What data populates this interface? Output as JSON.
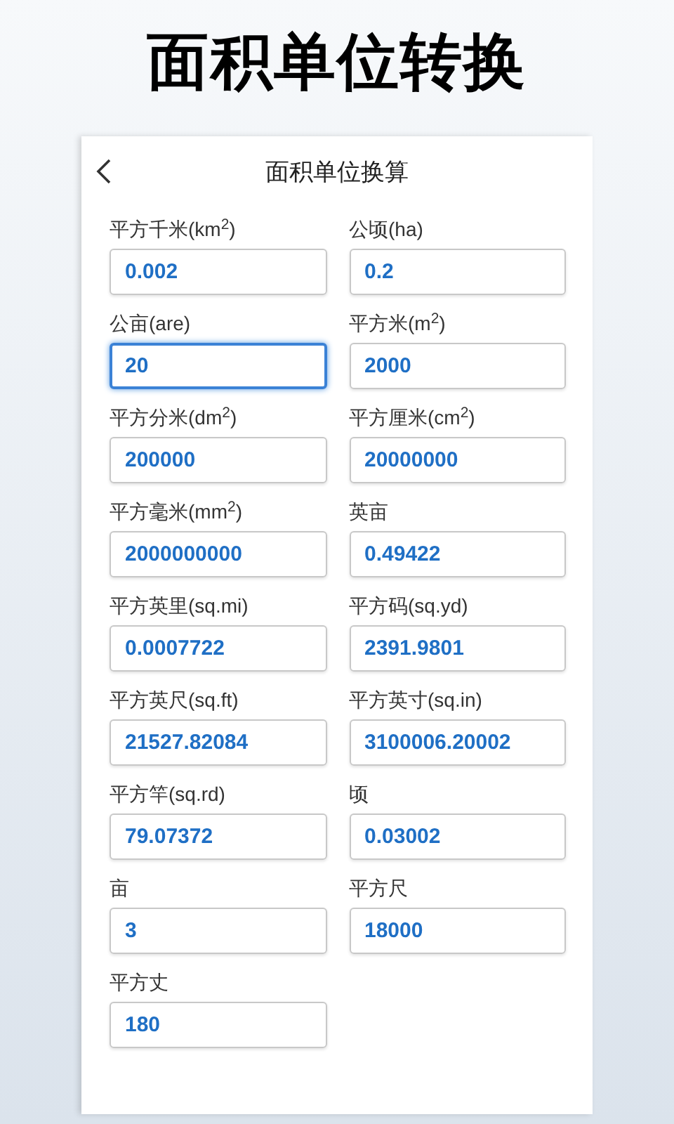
{
  "headline": "面积单位转换",
  "app_bar": {
    "title": "面积单位换算"
  },
  "fields": [
    {
      "label": "平方千米(km$^{2}$)",
      "value": "0.002",
      "focused": false
    },
    {
      "label": "公顷(ha)",
      "value": "0.2",
      "focused": false
    },
    {
      "label": "公亩(are)",
      "value": "20",
      "focused": true
    },
    {
      "label": "平方米(m$^{2}$)",
      "value": "2000",
      "focused": false
    },
    {
      "label": "平方分米(dm$^{2}$)",
      "value": "200000",
      "focused": false
    },
    {
      "label": "平方厘米(cm$^{2}$)",
      "value": "20000000",
      "focused": false
    },
    {
      "label": "平方毫米(mm$^{2}$)",
      "value": "2000000000",
      "focused": false
    },
    {
      "label": "英亩",
      "value": "0.49422",
      "focused": false
    },
    {
      "label": "平方英里(sq.mi)",
      "value": "0.0007722",
      "focused": false
    },
    {
      "label": "平方码(sq.yd)",
      "value": "2391.9801",
      "focused": false
    },
    {
      "label": "平方英尺(sq.ft)",
      "value": "21527.82084",
      "focused": false
    },
    {
      "label": "平方英寸(sq.in)",
      "value": "3100006.20002",
      "focused": false
    },
    {
      "label": "平方竿(sq.rd)",
      "value": "79.07372",
      "focused": false
    },
    {
      "label": "顷",
      "value": "0.03002",
      "focused": false
    },
    {
      "label": "亩",
      "value": "3",
      "focused": false
    },
    {
      "label": "平方尺",
      "value": "18000",
      "focused": false
    },
    {
      "label": "平方丈",
      "value": "180",
      "focused": false
    }
  ]
}
